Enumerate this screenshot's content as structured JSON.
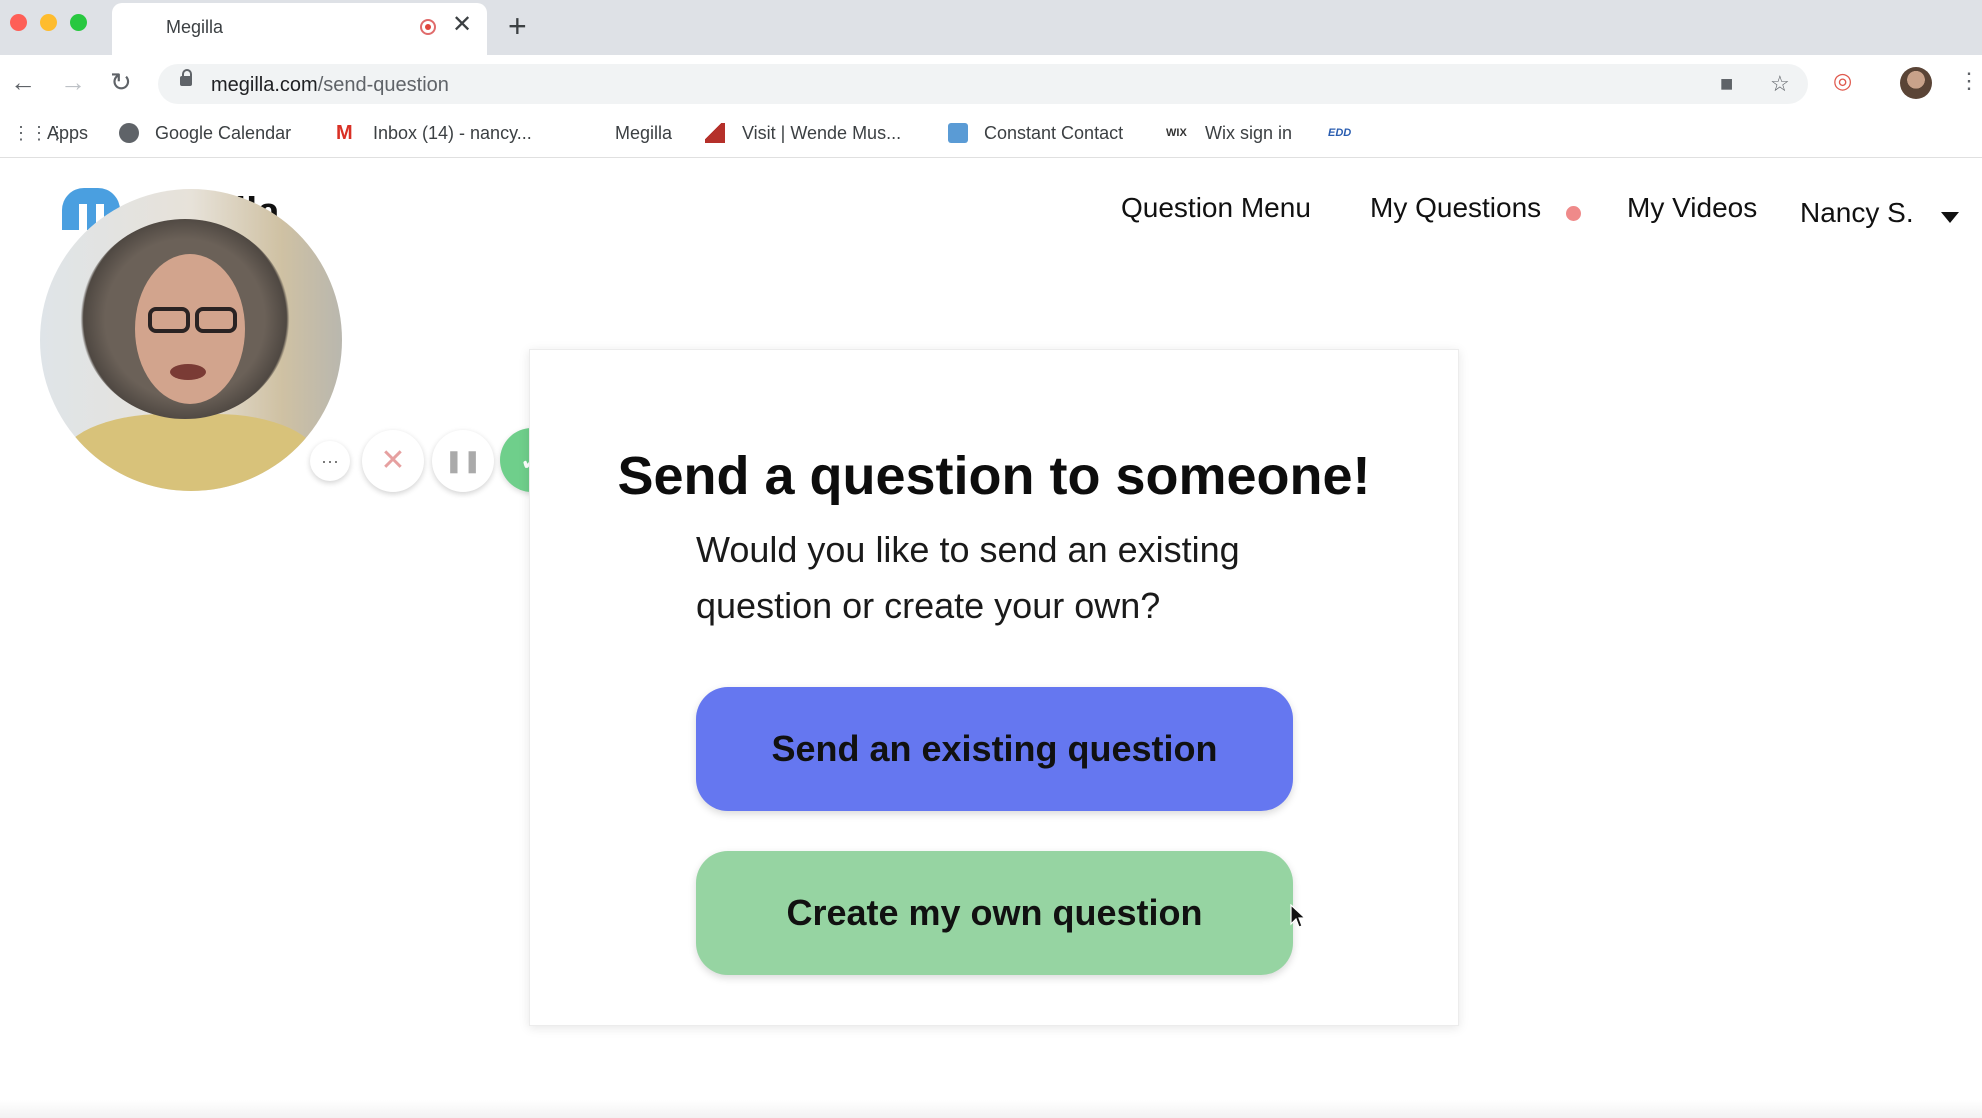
{
  "browser": {
    "tab_title": "Megilla",
    "tab_close": "✕",
    "new_tab": "+",
    "url_host": "megilla.com",
    "url_path": "/send-question"
  },
  "bookmarks": [
    {
      "label": "Apps",
      "icon": "apps-grid-icon"
    },
    {
      "label": "Google Calendar",
      "icon": "globe-icon"
    },
    {
      "label": "Inbox (14) - nancy...",
      "icon": "gmail-icon"
    },
    {
      "label": "Megilla",
      "icon": "none"
    },
    {
      "label": "Visit | Wende Mus...",
      "icon": "site-icon"
    },
    {
      "label": "Constant Contact",
      "icon": "constant-contact-icon"
    },
    {
      "label": "Wix sign in",
      "icon": "wix-icon"
    },
    {
      "label": "",
      "icon": "edd-icon",
      "icon_text": "EDD"
    }
  ],
  "site": {
    "logo_fragment": "lla"
  },
  "nav": {
    "question_menu": "Question Menu",
    "my_questions": "My Questions",
    "my_videos": "My Videos",
    "user_name": "Nancy S."
  },
  "recorder": {
    "more": "···",
    "cancel": "✕",
    "pause": "❚❚",
    "done": "✓"
  },
  "card": {
    "title": "Send a question to someone!",
    "subtitle": "Would you like to send an existing question or create your own?",
    "existing_button": "Send an existing question",
    "create_button": "Create my own question"
  },
  "colors": {
    "primary_button": "#6577f0",
    "secondary_button": "#96d4a2",
    "notification_dot": "#ef8a8a",
    "logo_blue": "#4a9fe0",
    "record_done": "#6fcf8b"
  }
}
